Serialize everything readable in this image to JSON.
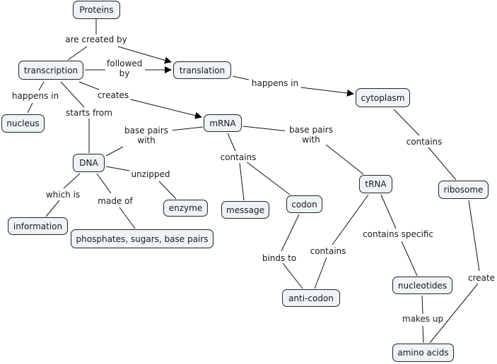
{
  "concept_map": {
    "nodes": {
      "proteins": "Proteins",
      "transcription": "transcription",
      "translation": "translation",
      "cytoplasm": "cytoplasm",
      "nucleus": "nucleus",
      "mrna": "mRNA",
      "dna": "DNA",
      "enzyme": "enzyme",
      "message": "message",
      "codon": "codon",
      "trna": "tRNA",
      "ribosome": "ribosome",
      "information": "information",
      "phosphates": "phosphates, sugars, base pairs",
      "anticodon": "anti-codon",
      "nucleotides": "nucleotides",
      "amino_acids": "amino acids"
    },
    "links": {
      "are_created_by": "are created by",
      "followed_by": "followed by",
      "happens_in_cytoplasm": "happens in",
      "happens_in_nucleus": "happens in",
      "starts_from": "starts from",
      "creates": "creates",
      "base_pairs_with_dna": "base pairs with",
      "base_pairs_with_trna": "base pairs with",
      "contains_mrna": "contains",
      "contains_ribosome": "contains",
      "unzipped": "unzipped",
      "which_is": "which is",
      "made_of": "made of",
      "binds_to": "binds to",
      "contains_anticodon": "contains",
      "contains_specific": "contains specific",
      "create": "create",
      "makes_up": "makes up"
    }
  }
}
